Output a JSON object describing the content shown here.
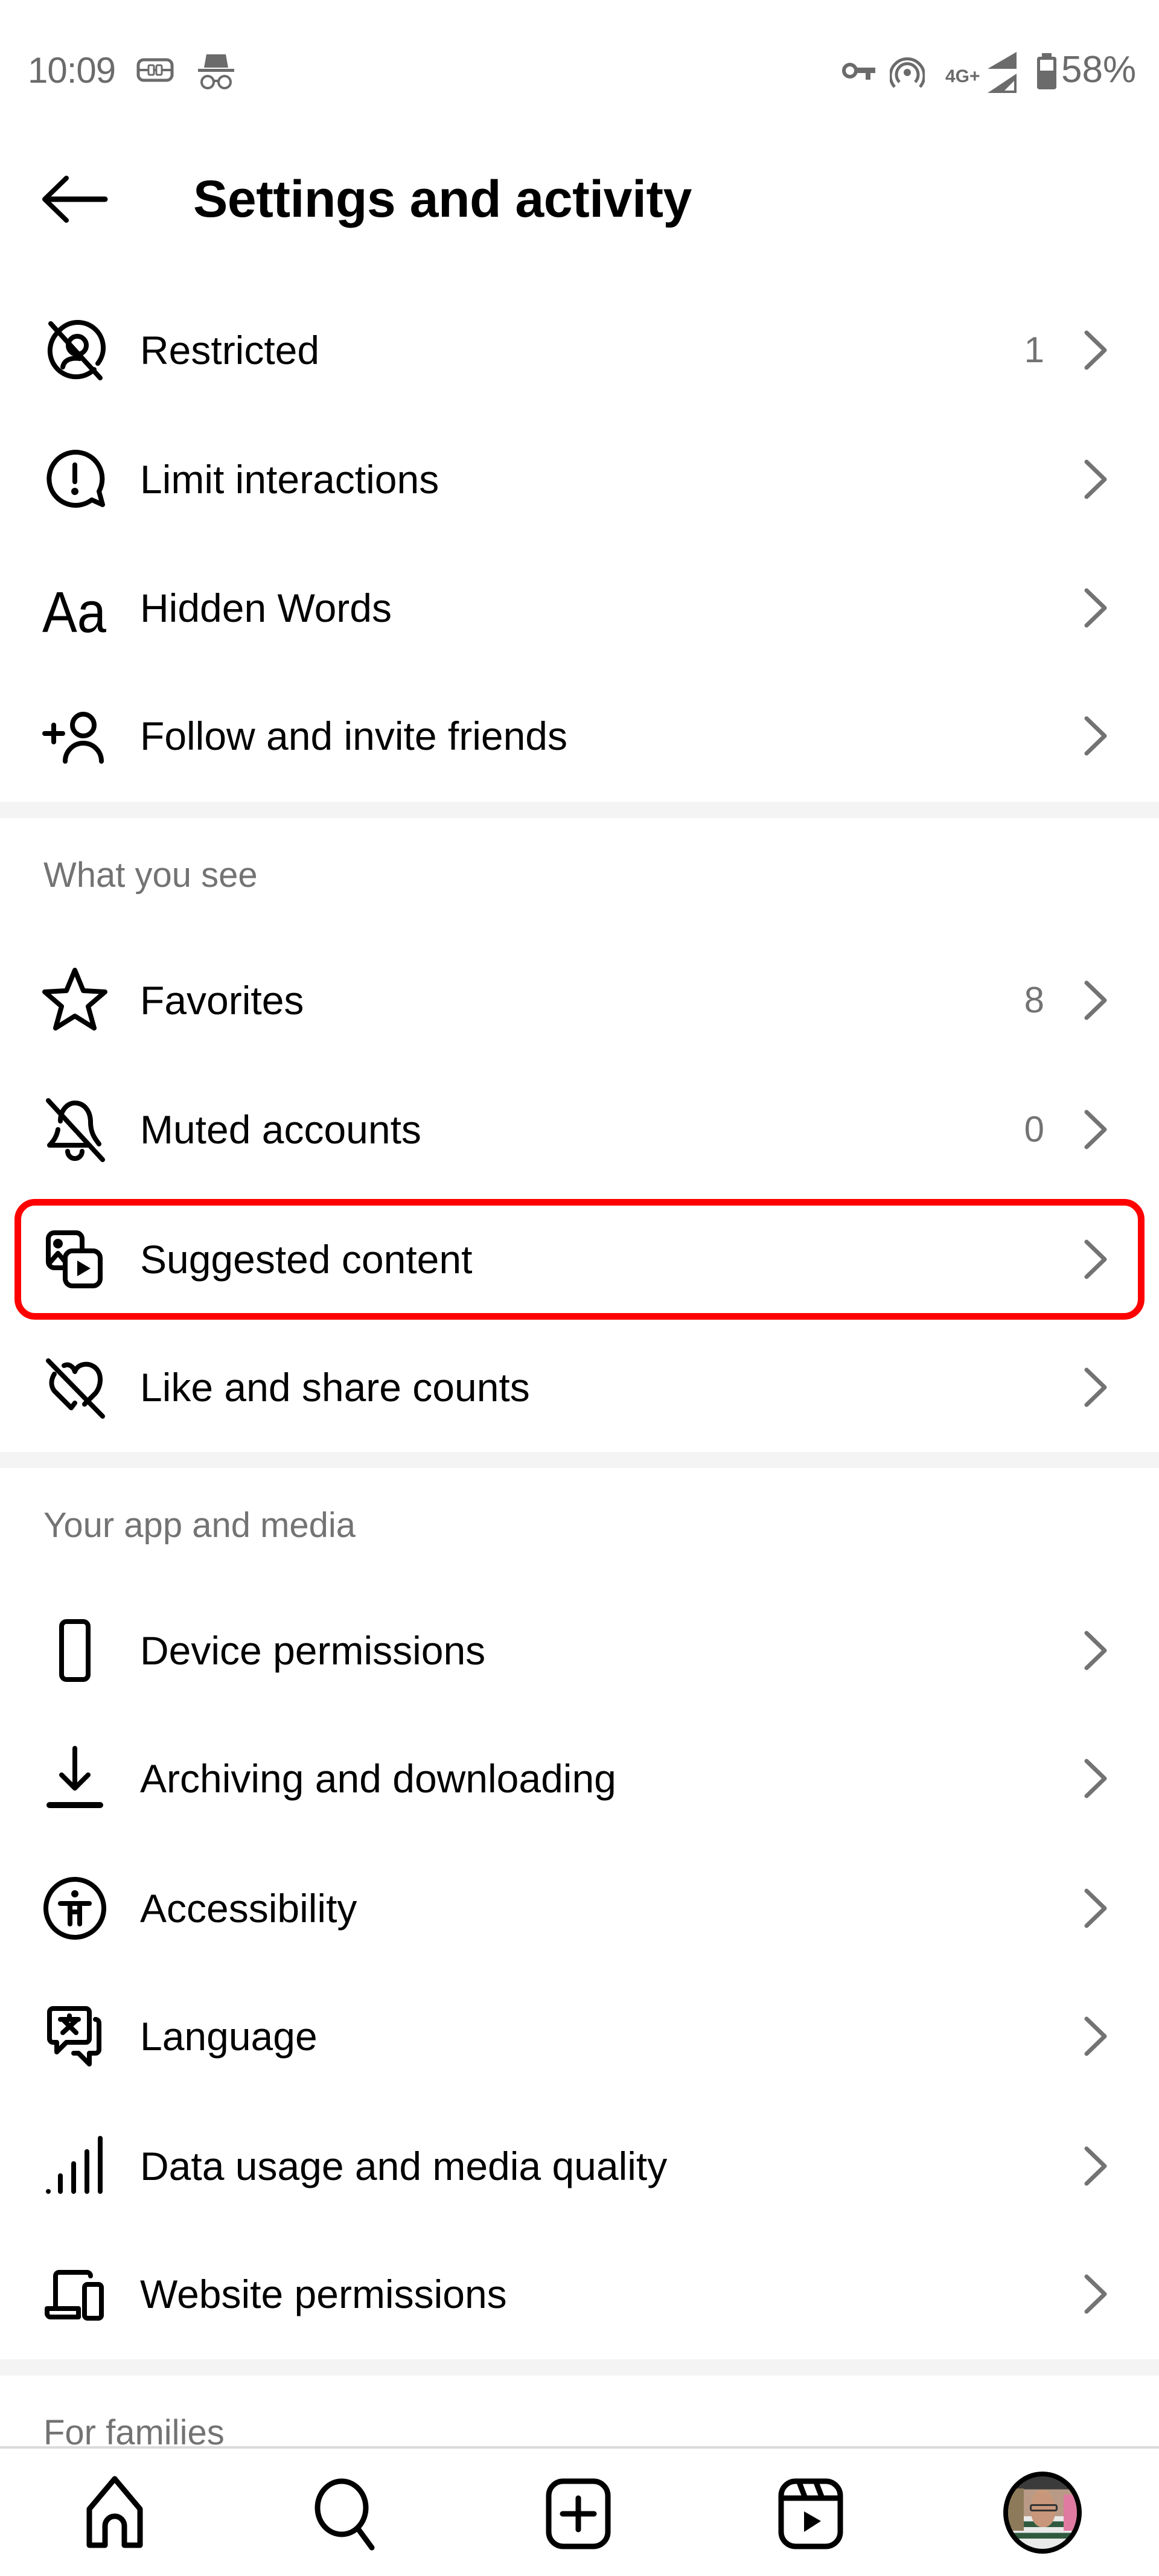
{
  "status_bar": {
    "time": "10:09",
    "left_icons": [
      "cast-link-icon",
      "incognito-icon"
    ],
    "right_icons": [
      "vpn-key-icon",
      "hotspot-icon",
      "signal-icon",
      "battery-icon"
    ],
    "network": "4G+",
    "battery": "58%"
  },
  "header": {
    "back_icon": "arrow-left-icon",
    "title": "Settings and activity"
  },
  "sections": [
    {
      "title": "",
      "items": [
        {
          "label": "Restricted",
          "icon": "restricted-icon",
          "count": "1"
        },
        {
          "label": "Limit interactions",
          "icon": "limit-interactions-icon",
          "count": ""
        },
        {
          "label": "Hidden Words",
          "icon": "hidden-words-icon",
          "count": ""
        },
        {
          "label": "Follow and invite friends",
          "icon": "add-person-icon",
          "count": ""
        }
      ]
    },
    {
      "title": "What you see",
      "items": [
        {
          "label": "Favorites",
          "icon": "star-icon",
          "count": "8"
        },
        {
          "label": "Muted accounts",
          "icon": "muted-bell-icon",
          "count": "0"
        },
        {
          "label": "Suggested content",
          "icon": "suggested-content-icon",
          "count": "",
          "highlighted": true
        },
        {
          "label": "Like and share counts",
          "icon": "hidden-heart-icon",
          "count": ""
        }
      ]
    },
    {
      "title": "Your app and media",
      "items": [
        {
          "label": "Device permissions",
          "icon": "phone-icon",
          "count": ""
        },
        {
          "label": "Archiving and downloading",
          "icon": "download-icon",
          "count": ""
        },
        {
          "label": "Accessibility",
          "icon": "accessibility-icon",
          "count": ""
        },
        {
          "label": "Language",
          "icon": "language-icon",
          "count": ""
        },
        {
          "label": "Data usage and media quality",
          "icon": "signal-bars-icon",
          "count": ""
        },
        {
          "label": "Website permissions",
          "icon": "devices-icon",
          "count": ""
        }
      ]
    },
    {
      "title": "For families",
      "items": []
    }
  ],
  "highlight_color": "#ff0000",
  "bottom_nav": [
    {
      "name": "home",
      "icon": "home-icon"
    },
    {
      "name": "search",
      "icon": "search-icon"
    },
    {
      "name": "create",
      "icon": "create-post-icon"
    },
    {
      "name": "reels",
      "icon": "reels-icon"
    },
    {
      "name": "profile",
      "icon": "profile-avatar"
    }
  ]
}
